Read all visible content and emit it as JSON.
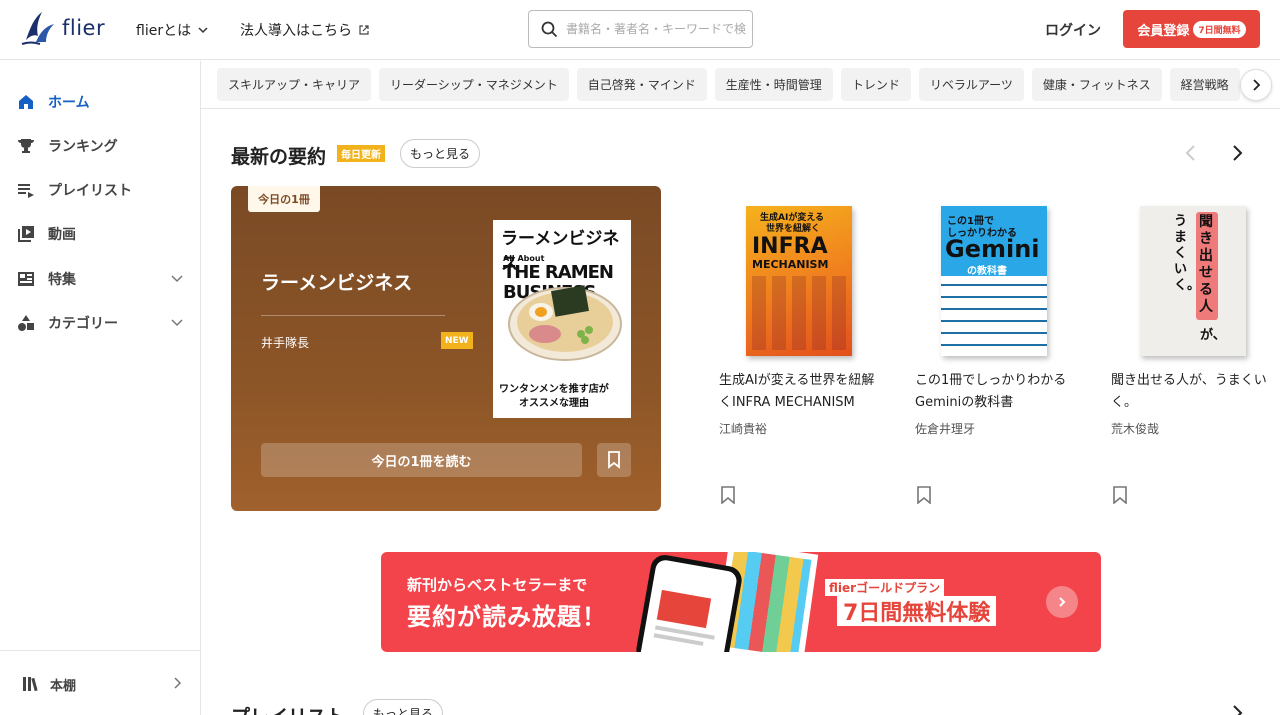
{
  "header": {
    "logo_text": "flier",
    "nav_about": "flierとは",
    "nav_corporate": "法人導入はこちら",
    "search_placeholder": "書籍名・著者名・キーワードで検索",
    "login": "ログイン",
    "signup": "会員登録",
    "signup_badge": "7日間無料"
  },
  "sidebar": {
    "items": [
      {
        "label": "ホーム",
        "icon": "home-icon",
        "active": true
      },
      {
        "label": "ランキング",
        "icon": "trophy-icon"
      },
      {
        "label": "プレイリスト",
        "icon": "playlist-icon"
      },
      {
        "label": "動画",
        "icon": "video-icon"
      },
      {
        "label": "特集",
        "icon": "feature-icon"
      },
      {
        "label": "カテゴリー",
        "icon": "category-icon"
      }
    ],
    "bookshelf": "本棚"
  },
  "categories": [
    "スキルアップ・キャリア",
    "リーダーシップ・マネジメント",
    "自己啓発・マインド",
    "生産性・時間管理",
    "トレンド",
    "リベラルアーツ",
    "健康・フィットネス",
    "経営戦略"
  ],
  "latest": {
    "title": "最新の要約",
    "badge": "毎日更新",
    "more": "もっと見る"
  },
  "feature": {
    "tab": "今日の1冊",
    "title": "ラーメンビジネス",
    "author": "井手隊長",
    "new_badge": "NEW",
    "read_button": "今日の1冊を読む",
    "cover": {
      "title": "ラーメンビジネス",
      "sub1": "All About",
      "sub2": "THE RAMEN",
      "sub3": "BUSINESS",
      "tagline1": "ワンタンメンを推す店が",
      "tagline2": "オススメな理由"
    }
  },
  "books": [
    {
      "title": "生成AIが変える世界を紐解くINFRA MECHANISM",
      "author": "江崎貴裕",
      "cover_lines": [
        "生成AIが変える",
        "世界を紐解く",
        "INFRA",
        "MECHANISM"
      ]
    },
    {
      "title": "この1冊でしっかりわかるGeminiの教科書",
      "author": "佐倉井理牙",
      "cover_lines": [
        "この1冊で",
        "しっかりわかる",
        "Gemini",
        "の教科書"
      ]
    },
    {
      "title": "聞き出せる人が、うまくいく。",
      "author": "荒木俊哉",
      "cover_lines": [
        "聞き出せる人",
        "が、",
        "うまくいく。"
      ]
    }
  ],
  "banner": {
    "line1": "新刊からベストセラーまで",
    "line2": "要約が読み放題！",
    "plan": "flierゴールドプラン",
    "trial": "7日間無料体験"
  },
  "playlist": {
    "title": "プレイリスト",
    "more": "もっと見る"
  },
  "colors": {
    "accent": "#e6453b",
    "active": "#1560c4",
    "badge": "#f1b21c"
  }
}
